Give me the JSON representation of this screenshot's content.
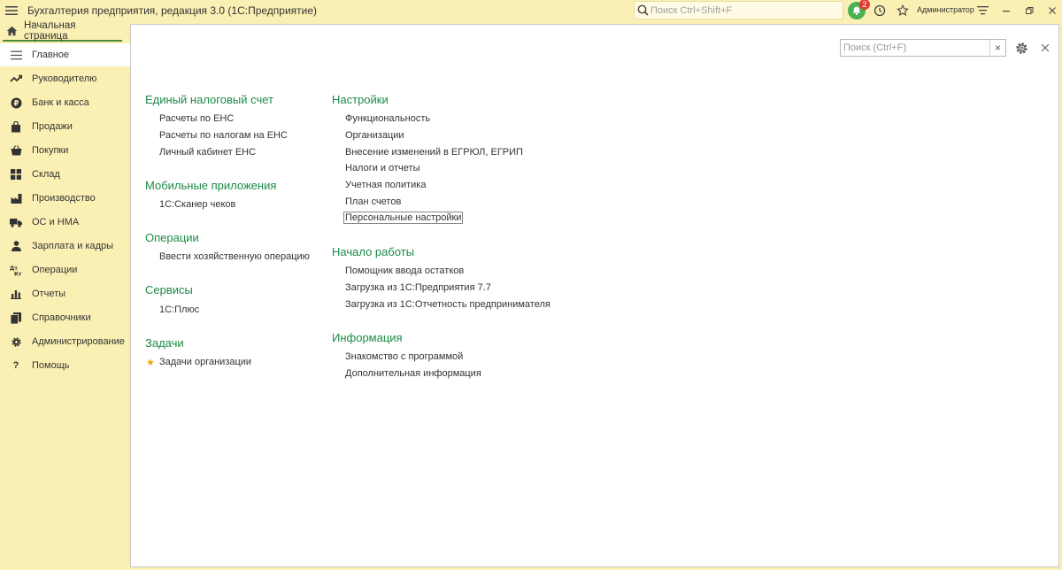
{
  "app": {
    "title": "Бухгалтерия предприятия, редакция 3.0  (1С:Предприятие)",
    "search_placeholder": "Поиск Ctrl+Shift+F",
    "notifications_count": "2",
    "user": "Администратор"
  },
  "tabs": {
    "home": "Начальная страница"
  },
  "sidebar": {
    "items": [
      {
        "label": "Главное",
        "icon": "menu-lines-icon"
      },
      {
        "label": "Руководителю",
        "icon": "trend-icon"
      },
      {
        "label": "Банк и касса",
        "icon": "coin-icon"
      },
      {
        "label": "Продажи",
        "icon": "bag-icon"
      },
      {
        "label": "Покупки",
        "icon": "basket-icon"
      },
      {
        "label": "Склад",
        "icon": "grid-icon"
      },
      {
        "label": "Производство",
        "icon": "factory-icon"
      },
      {
        "label": "ОС и НМА",
        "icon": "truck-icon"
      },
      {
        "label": "Зарплата и кадры",
        "icon": "person-icon"
      },
      {
        "label": "Операции",
        "icon": "dt-kt-icon"
      },
      {
        "label": "Отчеты",
        "icon": "bar-chart-icon"
      },
      {
        "label": "Справочники",
        "icon": "books-icon"
      },
      {
        "label": "Администрирование",
        "icon": "gear-icon"
      },
      {
        "label": "Помощь",
        "icon": "question-icon"
      }
    ]
  },
  "panel": {
    "search_placeholder": "Поиск (Ctrl+F)",
    "clear": "×"
  },
  "left_column": {
    "ens": {
      "title": "Единый налоговый счет",
      "links": [
        "Расчеты по ЕНС",
        "Расчеты по налогам на ЕНС",
        "Личный кабинет ЕНС"
      ]
    },
    "mobile": {
      "title": "Мобильные приложения",
      "links": [
        "1С:Сканер чеков"
      ]
    },
    "operations": {
      "title": "Операции",
      "links": [
        "Ввести хозяйственную операцию"
      ]
    },
    "services": {
      "title": "Сервисы",
      "links": [
        "1С:Плюс"
      ]
    },
    "tasks": {
      "title": "Задачи",
      "links": [
        "Задачи организации"
      ]
    }
  },
  "right_column": {
    "settings": {
      "title": "Настройки",
      "links": [
        "Функциональность",
        "Организации",
        "Внесение изменений в ЕГРЮЛ, ЕГРИП",
        "Налоги и отчеты",
        "Учетная политика",
        "План счетов",
        "Персональные настройки"
      ]
    },
    "start": {
      "title": "Начало работы",
      "links": [
        "Помощник ввода остатков",
        "Загрузка из 1С:Предприятия 7.7",
        "Загрузка из 1С:Отчетность предпринимателя"
      ]
    },
    "info": {
      "title": "Информация",
      "links": [
        "Знакомство с программой",
        "Дополнительная информация"
      ]
    }
  },
  "colors": {
    "background": "#fbf0b4",
    "section_title": "#1b8b45",
    "notification": "#4caf50",
    "badge": "#e53935"
  }
}
